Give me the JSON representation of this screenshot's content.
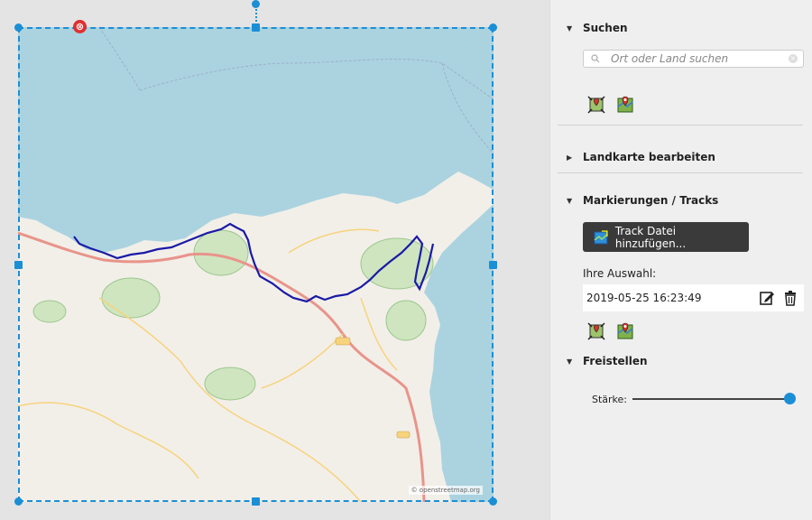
{
  "map": {
    "attribution": "© openstreetmap.org",
    "delete_symbol": "⊗",
    "track_color": "#1a1aa6",
    "selection_color": "#1a8fd6"
  },
  "sidebar": {
    "search": {
      "title": "Suchen",
      "placeholder": "Ort oder Land suchen",
      "value": ""
    },
    "edit_map": {
      "title": "Landkarte bearbeiten"
    },
    "markers": {
      "title": "Markierungen / Tracks",
      "add_track_label": "Track Datei hinzufügen...",
      "selection_label": "Ihre Auswahl:",
      "track_name": "2019-05-25 16:23:49"
    },
    "crop": {
      "title": "Freistellen",
      "strength_label": "Stärke:",
      "strength_value": 1.0
    }
  }
}
